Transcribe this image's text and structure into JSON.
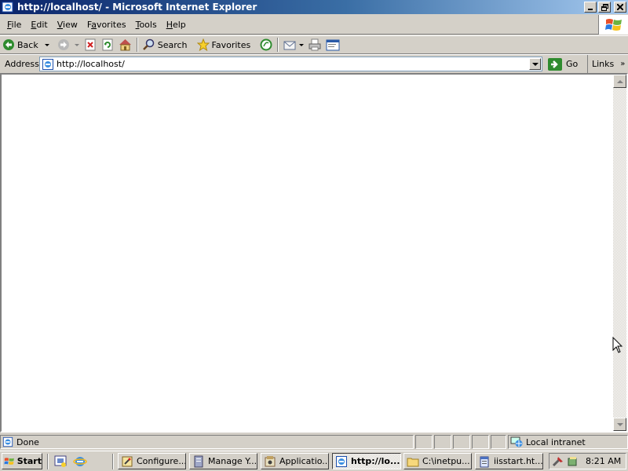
{
  "window": {
    "title": "http://localhost/ - Microsoft Internet Explorer",
    "minimize_icon": "minimize-icon",
    "restore_icon": "restore-icon",
    "close_icon": "close-icon"
  },
  "menubar": {
    "items": [
      {
        "prefix": "",
        "accel": "F",
        "rest": "ile"
      },
      {
        "prefix": "",
        "accel": "E",
        "rest": "dit"
      },
      {
        "prefix": "",
        "accel": "V",
        "rest": "iew"
      },
      {
        "prefix": "F",
        "accel": "a",
        "rest": "vorites"
      },
      {
        "prefix": "",
        "accel": "T",
        "rest": "ools"
      },
      {
        "prefix": "",
        "accel": "H",
        "rest": "elp"
      }
    ]
  },
  "toolbar": {
    "back_label": "Back",
    "search_label": "Search",
    "favorites_label": "Favorites"
  },
  "address": {
    "label": "Address",
    "value": "http://localhost/",
    "go_label": "Go",
    "links_label": "Links",
    "links_chevron": "»"
  },
  "status": {
    "text": "Done",
    "zone": "Local intranet"
  },
  "taskbar": {
    "start_label": "Start",
    "tasks": [
      {
        "label": "Configure...",
        "icon": "wizard-icon"
      },
      {
        "label": "Manage Y...",
        "icon": "server-icon"
      },
      {
        "label": "Applicatio...",
        "icon": "application-icon"
      },
      {
        "label": "http://lo...",
        "icon": "ie-icon"
      },
      {
        "label": "C:\\inetpu...",
        "icon": "folder-icon"
      },
      {
        "label": "iisstart.ht...",
        "icon": "notepad-icon"
      }
    ],
    "active_index": 3,
    "clock": "8:21 AM"
  },
  "colors": {
    "title_gradient_start": "#0a246a",
    "title_gradient_end": "#a6caf0",
    "chrome": "#d4d0c8",
    "go_green": "#2e8b2e",
    "back_green": "#2e8b2e"
  }
}
